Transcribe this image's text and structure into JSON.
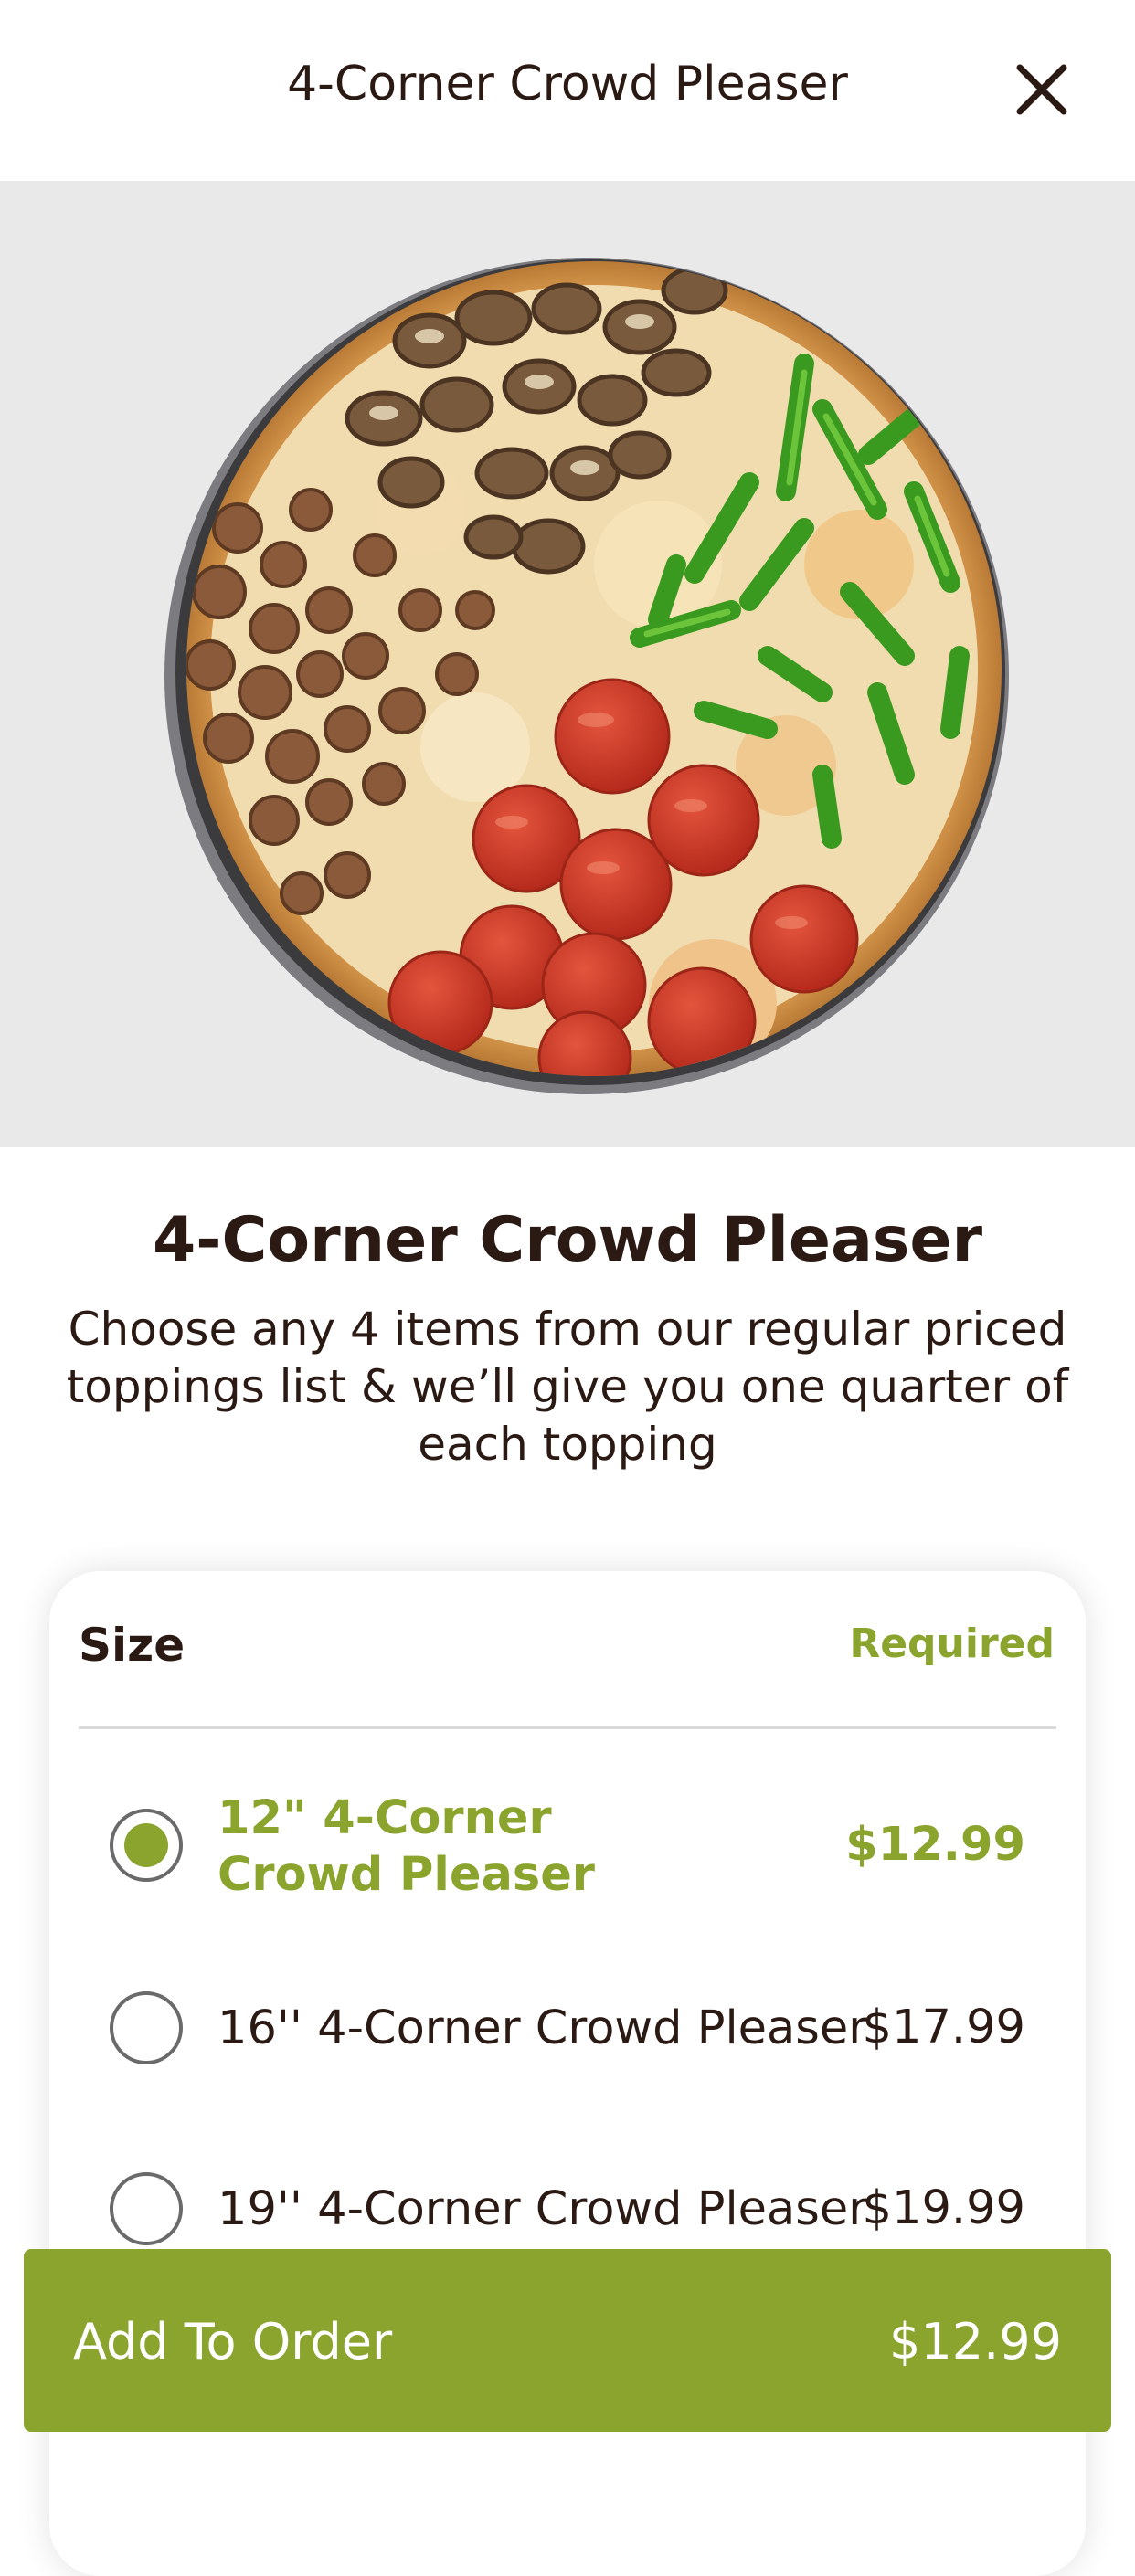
{
  "header": {
    "title": "4-Corner Crowd Pleaser",
    "close_icon": "close-icon"
  },
  "hero": {
    "image_subject": "pizza with four topping quarters: mushrooms, green peppers, pepperoni, sausage"
  },
  "product": {
    "title": "4-Corner Crowd Pleaser",
    "description": "Choose any 4 items from our regular priced toppings list & we’ll give you one quarter of each topping"
  },
  "size_section": {
    "label": "Size",
    "required_label": "Required",
    "options": [
      {
        "name": "12\" 4-Corner Crowd Pleaser",
        "price": "$12.99",
        "selected": true
      },
      {
        "name": "16'' 4-Corner Crowd Pleaser",
        "price": "$17.99",
        "selected": false
      },
      {
        "name": "19'' 4-Corner Crowd Pleaser",
        "price": "$19.99",
        "selected": false
      }
    ]
  },
  "order_bar": {
    "label": "Add To Order",
    "price": "$12.99"
  },
  "colors": {
    "accent": "#8aa42d",
    "text": "#2b1a14",
    "hero_background": "#e9e9ea"
  }
}
